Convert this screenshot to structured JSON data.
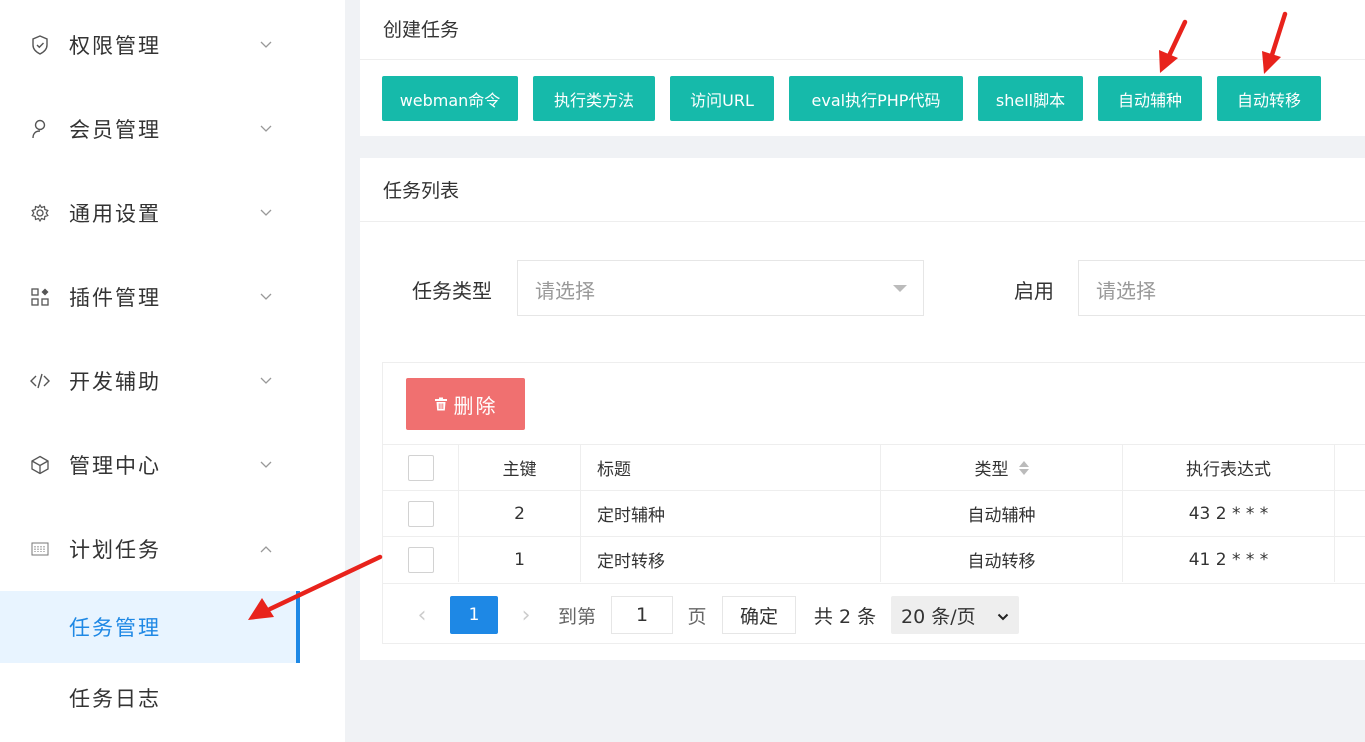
{
  "sidebar": {
    "items": [
      {
        "label": "权限管理",
        "icon": "shield-icon"
      },
      {
        "label": "会员管理",
        "icon": "user-icon"
      },
      {
        "label": "通用设置",
        "icon": "gear-icon"
      },
      {
        "label": "插件管理",
        "icon": "apps-icon"
      },
      {
        "label": "开发辅助",
        "icon": "code-icon"
      },
      {
        "label": "管理中心",
        "icon": "cube-icon"
      },
      {
        "label": "计划任务",
        "icon": "calendar-icon"
      }
    ],
    "subitems": [
      {
        "label": "任务管理",
        "active": true
      },
      {
        "label": "任务日志",
        "active": false
      }
    ]
  },
  "create_task": {
    "title": "创建任务",
    "buttons": [
      "webman命令",
      "执行类方法",
      "访问URL",
      "eval执行PHP代码",
      "shell脚本",
      "自动辅种",
      "自动转移"
    ]
  },
  "task_list": {
    "title": "任务列表",
    "filters": {
      "type_label": "任务类型",
      "type_placeholder": "请选择",
      "enabled_label": "启用",
      "enabled_placeholder": "请选择"
    },
    "delete_label": "删除",
    "columns": [
      "主键",
      "标题",
      "类型",
      "执行表达式"
    ],
    "rows": [
      {
        "id": "2",
        "title": "定时辅种",
        "type": "自动辅种",
        "expr": "43 2 * * *"
      },
      {
        "id": "1",
        "title": "定时转移",
        "type": "自动转移",
        "expr": "41 2 * * *"
      }
    ],
    "pagination": {
      "prev": "‹",
      "current_page": "1",
      "next": "›",
      "goto_label": "到第",
      "goto_value": "1",
      "page_unit": "页",
      "confirm": "确定",
      "total": "共 2 条",
      "page_size": "20 条/页"
    }
  },
  "colors": {
    "green": "#16baaa",
    "blue": "#1e88e5",
    "red": "#f07070",
    "annotation": "#e8231c"
  }
}
